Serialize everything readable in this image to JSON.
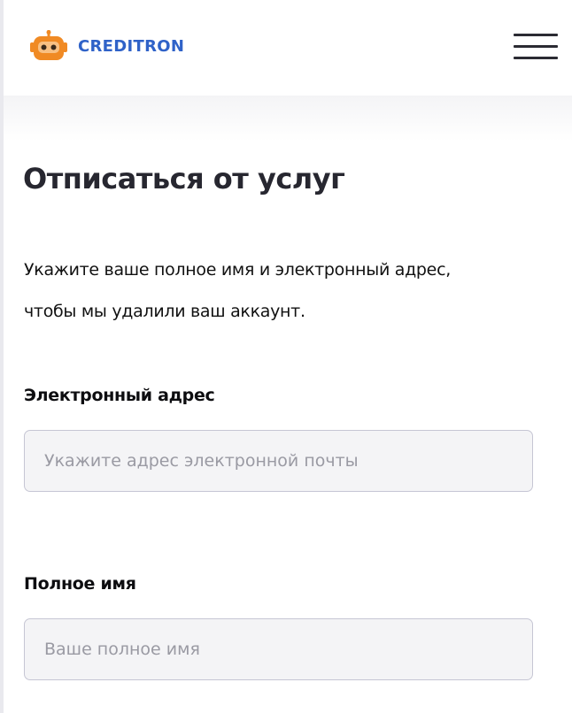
{
  "header": {
    "brand": "CREDITRON",
    "logo_icon": "robot-icon",
    "menu_icon": "hamburger-icon",
    "brand_color": "#2f62c8",
    "logo_color": "#f08a24"
  },
  "page": {
    "title": "Отписаться от услуг",
    "description_line1": "Укажите ваше полное имя и электронный адрес,",
    "description_line2": "чтобы мы удалили ваш аккаунт."
  },
  "form": {
    "email": {
      "label": "Электронный адрес",
      "placeholder": "Укажите адрес электронной почты",
      "value": ""
    },
    "full_name": {
      "label": "Полное имя",
      "placeholder": "Ваше полное имя",
      "value": ""
    }
  }
}
